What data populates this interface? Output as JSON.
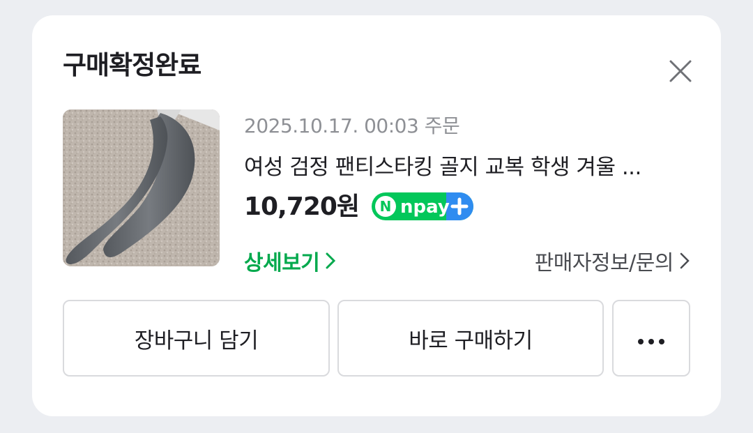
{
  "dialog": {
    "title": "구매확정완료"
  },
  "order": {
    "date": "2025.10.17. 00:03 주문",
    "product_name": "여성 검정 팬티스타킹 골지 교복 학생 겨울 ...",
    "price": "10,720원",
    "badge": "npay",
    "detail_link": "상세보기",
    "seller_link": "판매자정보/문의"
  },
  "actions": {
    "cart": "장바구니 담기",
    "buy": "바로 구매하기"
  },
  "colors": {
    "accent_green": "#03a94d",
    "npay_green": "#03c75a",
    "npay_blue": "#2f8cf0"
  }
}
